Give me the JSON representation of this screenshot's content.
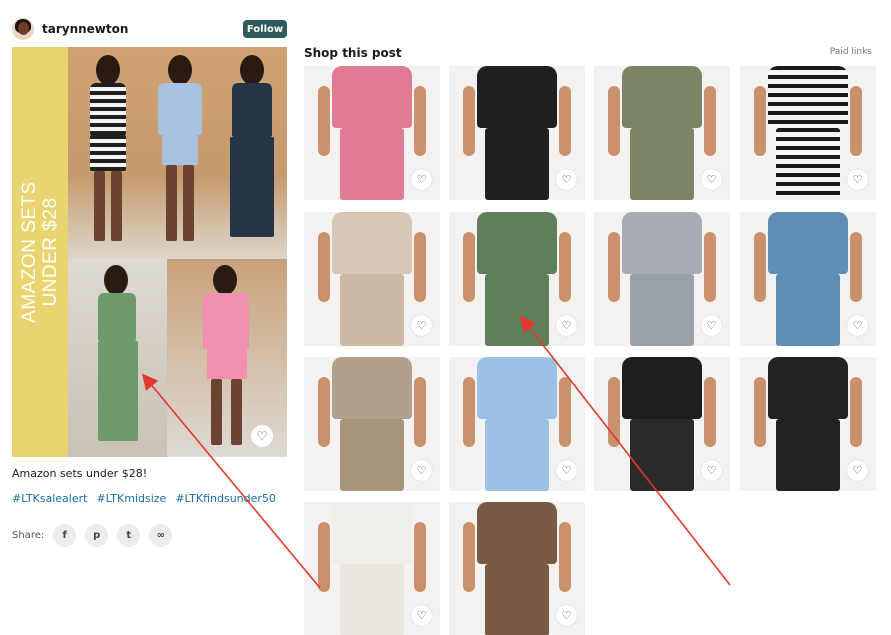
{
  "profile": {
    "username": "tarynnewton",
    "follow_label": "Follow"
  },
  "hero": {
    "title_line1": "AMAZON SETS",
    "title_line2": "UNDER $28",
    "band_color": "#e9d46f"
  },
  "post": {
    "caption": "Amazon sets under $28!",
    "hashtags": [
      "#LTKsalealert",
      "#LTKmidsize",
      "#LTKfindsunder50"
    ],
    "share_label": "Share:",
    "share_icons": [
      "facebook-icon",
      "pinterest-icon",
      "twitter-icon",
      "link-icon"
    ]
  },
  "shop": {
    "title": "Shop this post",
    "paid_label": "Paid links",
    "products": [
      {
        "name": "pink-set",
        "top": "#e07b93",
        "bottom": "#e07b93"
      },
      {
        "name": "black-wide-leg-set",
        "top": "#1f1f1f",
        "bottom": "#1f1f1f"
      },
      {
        "name": "olive-short-set",
        "top": "#7c8466",
        "bottom": "#7c8466"
      },
      {
        "name": "striped-short-set",
        "top": "stripe",
        "bottom": "stripe"
      },
      {
        "name": "beige-pants",
        "top": "#d8c7b4",
        "bottom": "#cbb9a3"
      },
      {
        "name": "green-pants",
        "top": "#5f7e5a",
        "bottom": "#5f7e5a"
      },
      {
        "name": "grey-ribbed-set",
        "top": "#a7acb3",
        "bottom": "#9aa0a8"
      },
      {
        "name": "blue-ribbed-set",
        "top": "#5f8fb4",
        "bottom": "#5f8fb4"
      },
      {
        "name": "taupe-ribbed-set",
        "top": "#b2a08a",
        "bottom": "#a8957d"
      },
      {
        "name": "light-blue-set",
        "top": "#9cc1e4",
        "bottom": "#9cc1e4"
      },
      {
        "name": "black-tee",
        "top": "#1e1e1e",
        "bottom": "#2a2a2a"
      },
      {
        "name": "black-pants",
        "top": "#222222",
        "bottom": "#222222"
      },
      {
        "name": "white-pants",
        "top": "#f0eee9",
        "bottom": "#e9e6e0"
      },
      {
        "name": "brown-ribbed-set",
        "top": "#7a5a45",
        "bottom": "#7a5a45"
      }
    ]
  },
  "annotation_color": "#e03a2f"
}
